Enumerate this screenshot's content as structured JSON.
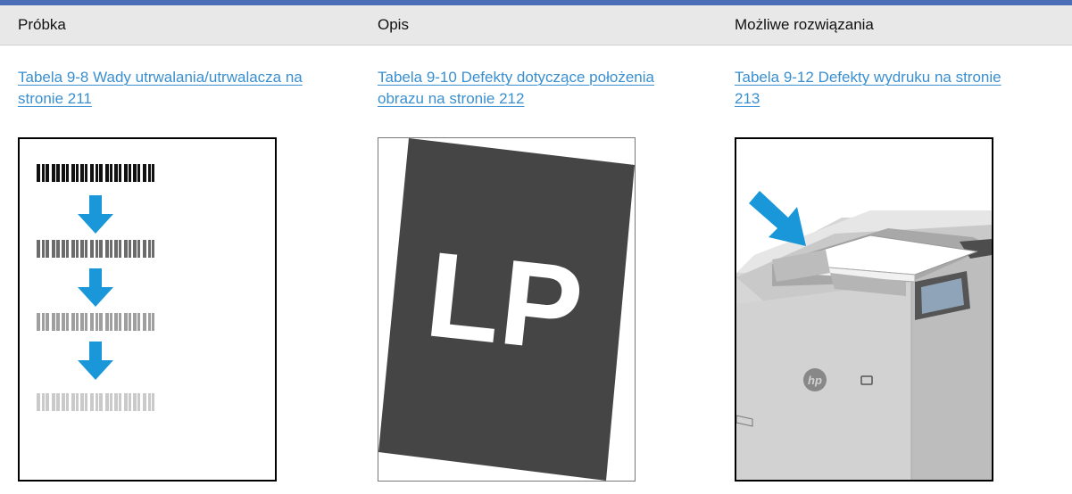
{
  "header": {
    "col1": "Próbka",
    "col2": "Opis",
    "col3": "Możliwe rozwiązania"
  },
  "links": {
    "link1_line1": "Tabela 9-8 Wady utrwalania/utrwalacza na",
    "link1_line2": "stronie 211",
    "link2_line1": "Tabela 9-10 Defekty dotyczące położenia",
    "link2_line2": "obrazu na stronie 212",
    "link3_line1": "Tabela 9-12 Defekty wydruku na stronie",
    "link3_line2": "213"
  },
  "images": {
    "sample2_text": "LP",
    "printer_logo": "hp"
  },
  "colors": {
    "header_bar": "#4a6db7",
    "header_bg": "#e8e8e8",
    "link": "#3a8fd0",
    "arrow": "#1a97d9",
    "dark_page": "#454545"
  }
}
